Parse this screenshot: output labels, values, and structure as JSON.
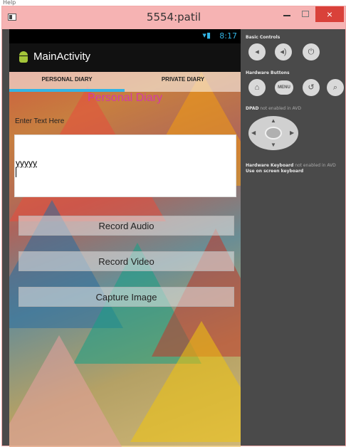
{
  "window": {
    "help_text": "Help",
    "title": "5554:patil",
    "close_glyph": "×"
  },
  "device": {
    "status_time": "8:17",
    "status_icons": "▾▮",
    "app_title": "MainActivity",
    "tabs": [
      {
        "label": "PERSONAL DIARY",
        "selected": true
      },
      {
        "label": "PRIVATE DIARY",
        "selected": false
      }
    ],
    "page_heading": "Personal Diary",
    "prompt_label": "Enter Text Here",
    "text_value": "yyyyy",
    "buttons": {
      "record_audio": "Record Audio",
      "record_video": "Record Video",
      "capture_image": "Capture Image"
    }
  },
  "emulator": {
    "basic_controls_label": "Basic Controls",
    "hardware_buttons_label": "Hardware Buttons",
    "menu_label": "MENU",
    "dpad_label": "DPAD",
    "dpad_note": " not enabled in AVD",
    "keyboard_label": "Hardware Keyboard",
    "keyboard_note": " not enabled in AVD",
    "onscreen_keyboard_label": "Use on screen keyboard",
    "icons": [
      "volume-down-icon",
      "volume-up-icon",
      "power-icon",
      "home-icon",
      "menu-icon",
      "back-icon",
      "search-icon"
    ]
  },
  "colors": {
    "accent_blue": "#33b5e5",
    "heading_pink": "#d43ba6",
    "close_red": "#d9413a",
    "titlebar_pink": "#f6b3b3"
  }
}
